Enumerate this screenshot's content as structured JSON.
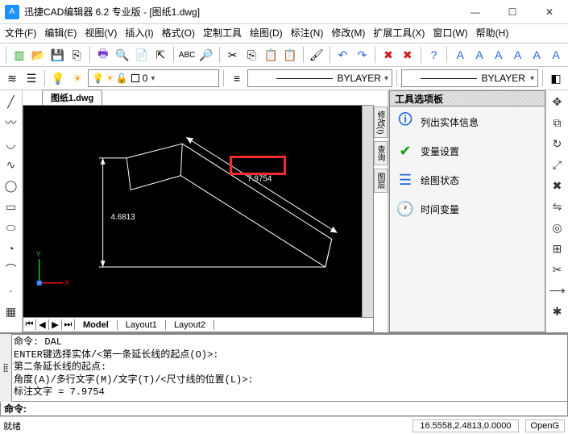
{
  "title": "迅捷CAD编辑器 6.2 专业版  - [图纸1.dwg]",
  "menus": {
    "file": "文件(F)",
    "edit": "编辑(E)",
    "view": "视图(V)",
    "insert": "插入(I)",
    "format": "格式(O)",
    "custom": "定制工具",
    "draw": "绘图(D)",
    "dim": "标注(N)",
    "modify": "修改(M)",
    "ext": "扩展工具(X)",
    "window": "窗口(W)",
    "help": "帮助(H)"
  },
  "linetype1": "BYLAYER",
  "linetype2": "BYLAYER",
  "docTab": "图纸1.dwg",
  "dimA": "4.6813",
  "dimB": "7.9754",
  "layoutTabs": {
    "model": "Model",
    "l1": "Layout1",
    "l2": "Layout2"
  },
  "palette": {
    "title": "工具选项板",
    "i1": "列出实体信息",
    "i2": "变量设置",
    "i3": "绘图状态",
    "i4": "时间变量"
  },
  "sideTabs": {
    "a": "修改(I)",
    "b": "查询",
    "c": "图层"
  },
  "command_history": "命令: DAL\nENTER键选择实体/<第一条延长线的起点(O)>:\n第二条延长线的起点:\n角度(A)/多行文字(M)/文字(T)/<尺寸线的位置(L)>:\n标注文字 = 7.9754",
  "command_prompt": "命令:",
  "status_left": "就绪",
  "status_coord": "16.5558,2.4813,0.0000",
  "status_mode": "OpenG"
}
